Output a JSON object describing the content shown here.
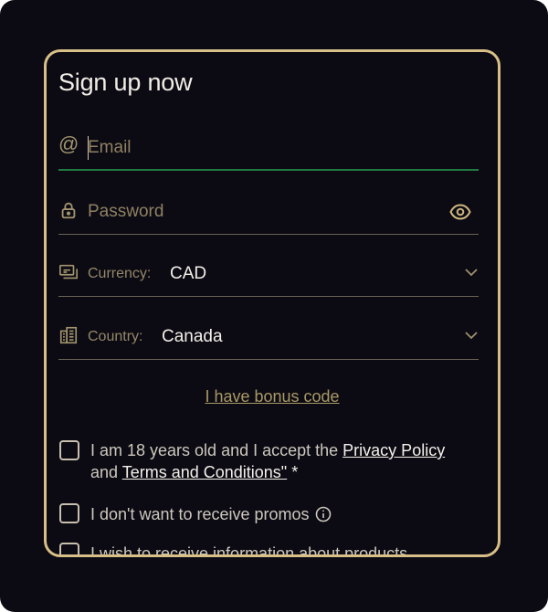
{
  "form": {
    "title": "Sign up now",
    "email": {
      "placeholder": "Email",
      "value": ""
    },
    "password": {
      "placeholder": "Password",
      "value": ""
    },
    "currency": {
      "label": "Currency:",
      "value": "CAD"
    },
    "country": {
      "label": "Country:",
      "value": "Canada"
    },
    "bonus_link": "I have bonus code",
    "consents": {
      "age_prefix": "I am 18 years old and I accept the ",
      "privacy_link": "Privacy Policy",
      "and": " and ",
      "terms_link": "Terms and Conditions\"",
      "required_mark": " *",
      "no_promos": "I don't want to receive promos",
      "info_products": "I wish to receive information about products"
    }
  },
  "colors": {
    "background": "#0c0b13",
    "card_border": "#d8bf87",
    "active_underline": "#1f7a43",
    "muted_gold": "#a2946e"
  },
  "icons": {
    "email": "at-icon",
    "password": "lock-icon",
    "show_password": "eye-icon",
    "currency": "money-icon",
    "country": "building-icon",
    "dropdown": "chevron-down-icon",
    "info": "info-icon"
  }
}
